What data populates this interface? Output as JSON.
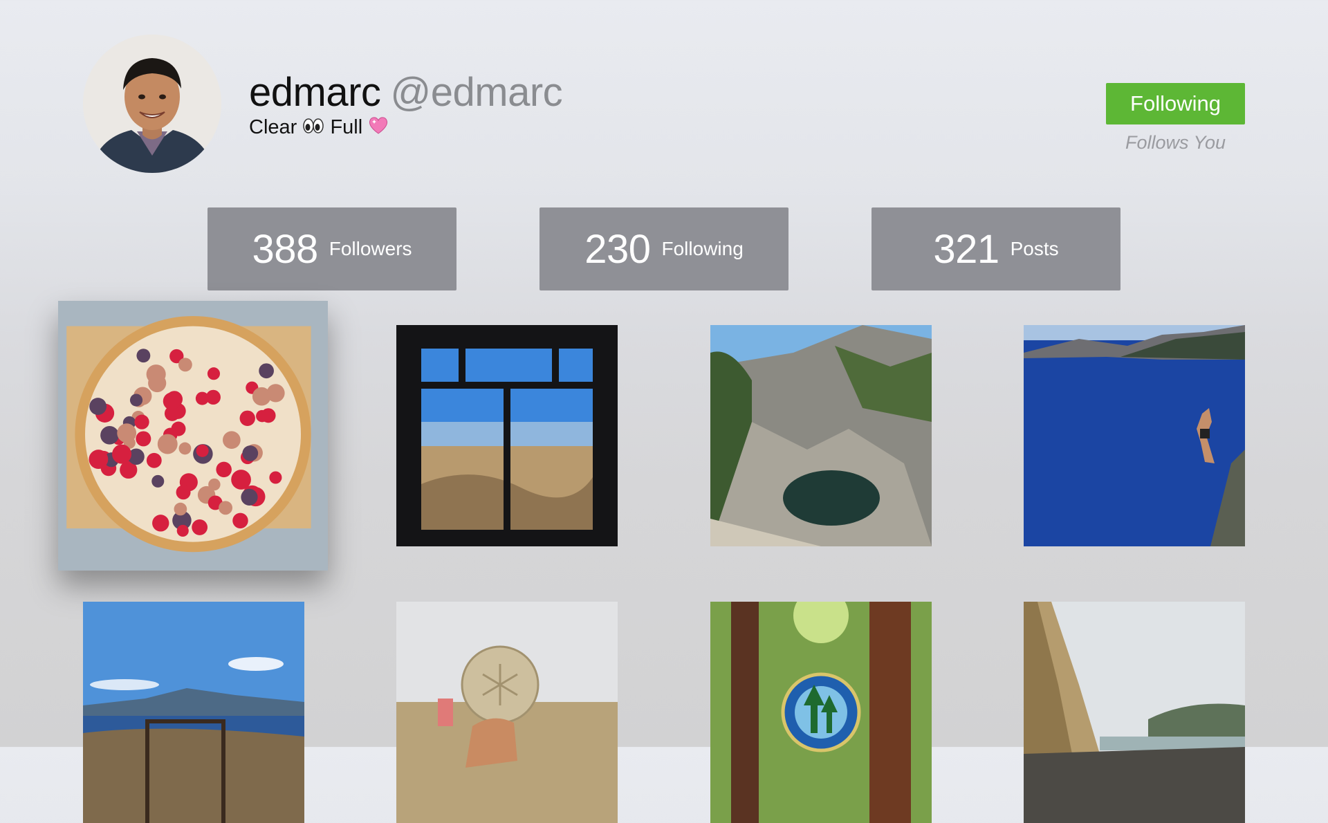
{
  "profile": {
    "display_name": "edmarc",
    "handle": "@edmarc",
    "bio_part1": "Clear",
    "bio_part2": "Full",
    "eyes_icon": "eyes-emoji",
    "heart_icon": "sparkling-heart-emoji"
  },
  "actions": {
    "follow_label": "Following",
    "follows_you_label": "Follows You",
    "follow_color": "#5db735"
  },
  "stats": {
    "followers": {
      "count": "388",
      "label": "Followers"
    },
    "following": {
      "count": "230",
      "label": "Following"
    },
    "posts": {
      "count": "321",
      "label": "Posts"
    }
  },
  "posts": [
    {
      "subject": "fig-raspberry-tart",
      "focused": true
    },
    {
      "subject": "window-valley-view"
    },
    {
      "subject": "river-canyon"
    },
    {
      "subject": "cliff-jump-lake"
    },
    {
      "subject": "crater-lake-viewpoint"
    },
    {
      "subject": "sand-dollar-beach"
    },
    {
      "subject": "big-basin-redwoods-sign"
    },
    {
      "subject": "coastal-cliffs"
    }
  ]
}
